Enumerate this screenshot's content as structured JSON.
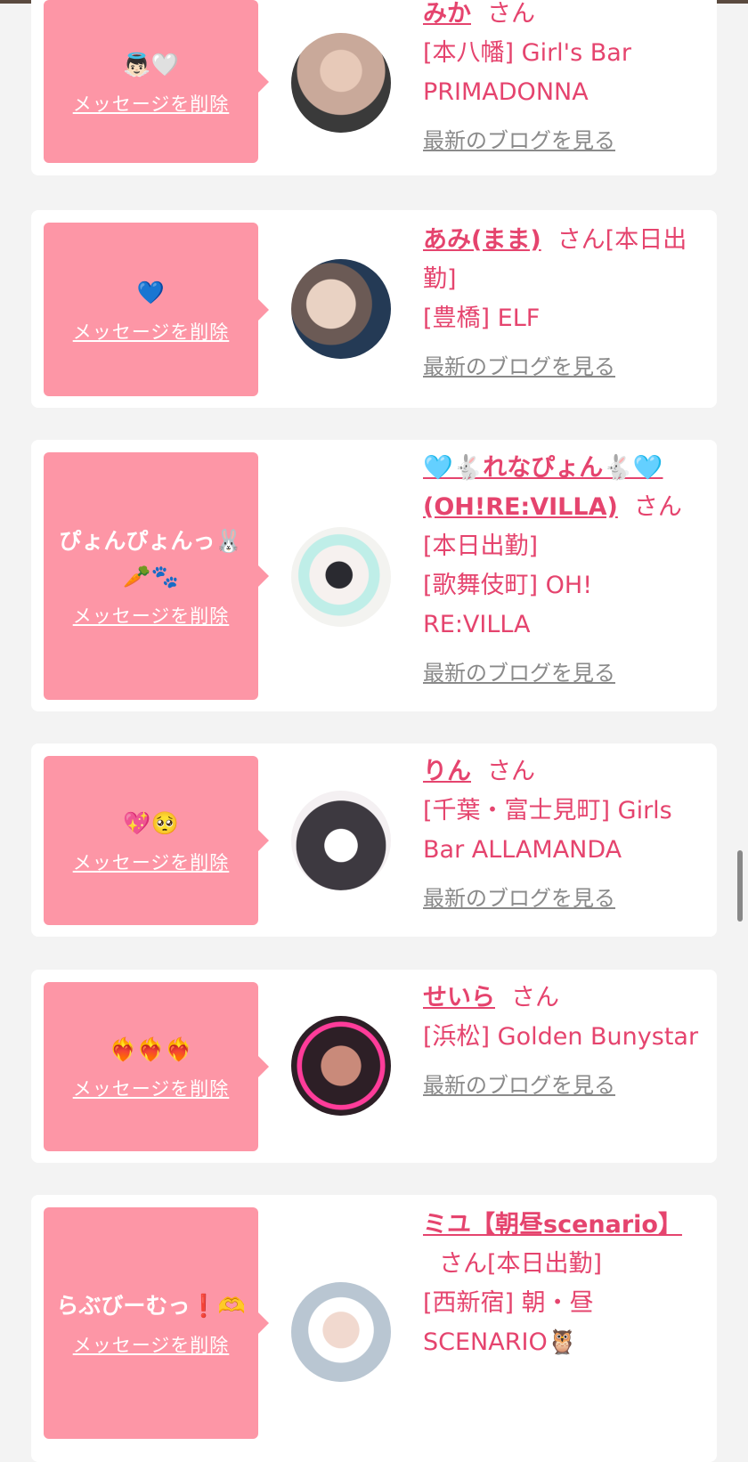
{
  "common": {
    "delete_label": "メッセージを削除",
    "blog_label": "最新のブログを見る"
  },
  "cards": [
    {
      "message": "👼🏻🤍",
      "name": "みか",
      "san": "さん",
      "shop": "[本八幡] Girl's Bar PRIMADONNA",
      "avatar_colors": [
        "#c9a99a",
        "#3a3a3a"
      ]
    },
    {
      "message": "💙",
      "name": "あみ(まま)",
      "san": "さん[本日出勤]",
      "shop": "[豊橋] ELF",
      "avatar_colors": [
        "#d8c3b2",
        "#243a55"
      ]
    },
    {
      "message": "ぴょんぴょんっ🐰🥕🐾",
      "name": "🩵🐇れなぴょん🐇🩵(OH!RE:VILLA)",
      "san": "さん",
      "extra": "[本日出勤]",
      "shop": "[歌舞伎町] OH! RE:VILLA",
      "avatar_colors": [
        "#f3f3f0",
        "#8fe0d8"
      ]
    },
    {
      "message": "💖🥺",
      "name": "りん",
      "san": "さん",
      "shop": "[千葉・富士見町] Girls Bar ALLAMANDA",
      "avatar_colors": [
        "#3d3940",
        "#f4f0f2"
      ]
    },
    {
      "message": "❤️‍🔥❤️‍🔥❤️‍🔥",
      "name": "せいら",
      "san": "さん",
      "shop": "[浜松] Golden Bunystar",
      "avatar_colors": [
        "#2d1f26",
        "#ff3c9a"
      ]
    },
    {
      "message": "らぶびーむっ❗🫶",
      "name": "ミユ【朝昼scenario】",
      "san": "さん[本日出勤]",
      "shop": "[西新宿] 朝・昼SCENARIO🦉",
      "avatar_colors": [
        "#e8e8ee",
        "#b9c6d2"
      ]
    }
  ]
}
